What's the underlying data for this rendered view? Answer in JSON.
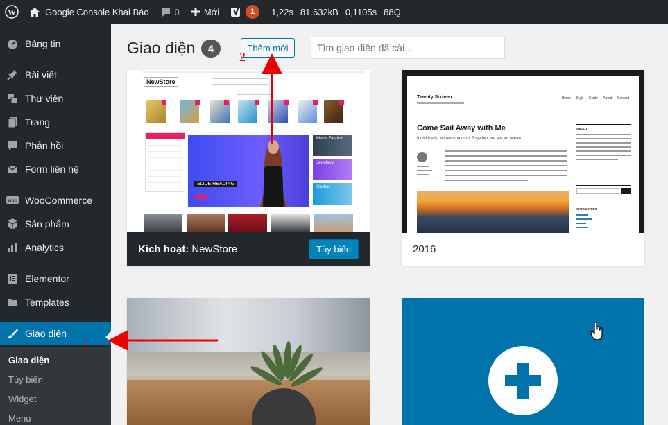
{
  "adminbar": {
    "site_name": "Google Console Khai Báo",
    "comments_count": "0",
    "new_label": "Mới",
    "yoast_badge": "1",
    "stats": [
      "1,22s",
      "81.632kB",
      "0,1105s",
      "88Q"
    ]
  },
  "sidebar": {
    "items": [
      {
        "icon": "dashboard-icon",
        "label": "Bảng tin"
      },
      {
        "icon": "pin-icon",
        "label": "Bài viết"
      },
      {
        "icon": "media-icon",
        "label": "Thư viện"
      },
      {
        "icon": "page-icon",
        "label": "Trang"
      },
      {
        "icon": "comment-icon",
        "label": "Phản hồi"
      },
      {
        "icon": "mail-icon",
        "label": "Form liên hệ"
      },
      {
        "icon": "woo-icon",
        "label": "WooCommerce"
      },
      {
        "icon": "box-icon",
        "label": "Sản phẩm"
      },
      {
        "icon": "bar-chart-icon",
        "label": "Analytics"
      },
      {
        "icon": "elementor-icon",
        "label": "Elementor"
      },
      {
        "icon": "folder-icon",
        "label": "Templates"
      },
      {
        "icon": "brush-icon",
        "label": "Giao diện"
      }
    ],
    "submenu": [
      "Giao diện",
      "Tùy biến",
      "Widget",
      "Menu"
    ]
  },
  "header": {
    "title": "Giao diện",
    "count": "4",
    "add_new": "Thêm mới",
    "search_placeholder": "Tìm giao diện đã cài..."
  },
  "themes": {
    "active": {
      "prefix": "Kích hoạt:",
      "name": "NewStore",
      "customize": "Tùy biến"
    },
    "second": {
      "name": "2016"
    },
    "newstore_shot": {
      "logo": "NewStore",
      "slide_heading": "SLIDE HEADING",
      "tiles": [
        "Men's Fashion",
        "Jewellery",
        "Clothes"
      ]
    },
    "twentysixteen_shot": {
      "site_title": "Twenty Sixteen",
      "nav": "Home Style Guide About Contact",
      "headline": "Come Sail Away with Me",
      "subhead": "Individually, we are one drop. Together, we are an ocean.",
      "sidebar_about": "ABOUT",
      "sidebar_categories": "CATEGORIES"
    }
  },
  "annotations": {
    "first": "1",
    "second": "2"
  },
  "colors": {
    "admin_dark": "#23282d",
    "accent": "#0073aa",
    "arrow": "#e00000"
  }
}
